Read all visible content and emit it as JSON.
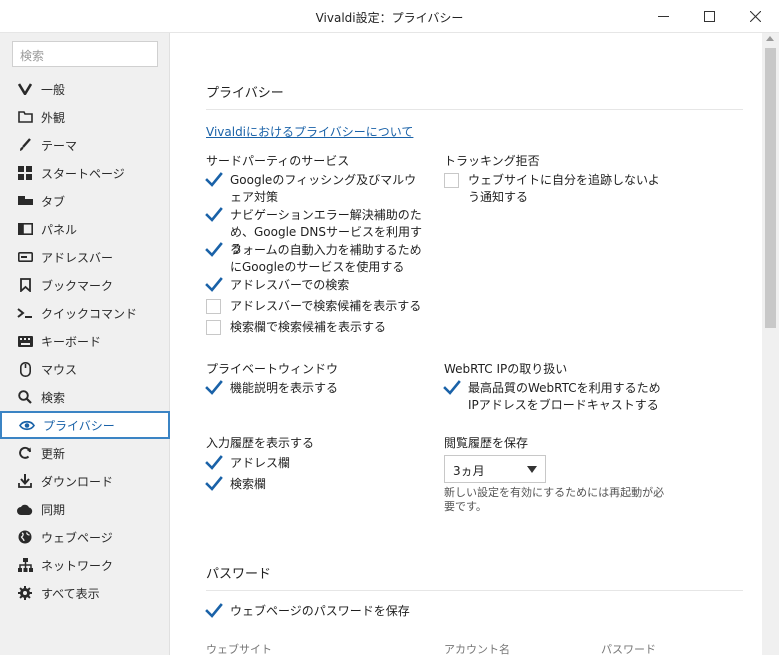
{
  "window": {
    "title": "Vivaldi設定：プライバシー"
  },
  "sidebar": {
    "search_placeholder": "検索",
    "items": [
      {
        "label": "一般",
        "icon": "vivaldi-v-icon"
      },
      {
        "label": "外観",
        "icon": "folder-icon"
      },
      {
        "label": "テーマ",
        "icon": "brush-icon"
      },
      {
        "label": "スタートページ",
        "icon": "grid-icon"
      },
      {
        "label": "タブ",
        "icon": "tab-icon"
      },
      {
        "label": "パネル",
        "icon": "panel-icon"
      },
      {
        "label": "アドレスバー",
        "icon": "address-bar-icon"
      },
      {
        "label": "ブックマーク",
        "icon": "bookmark-icon"
      },
      {
        "label": "クイックコマンド",
        "icon": "quick-command-icon"
      },
      {
        "label": "キーボード",
        "icon": "keyboard-icon"
      },
      {
        "label": "マウス",
        "icon": "mouse-icon"
      },
      {
        "label": "検索",
        "icon": "search-icon"
      },
      {
        "label": "プライバシー",
        "icon": "eye-icon",
        "active": true
      },
      {
        "label": "更新",
        "icon": "refresh-icon"
      },
      {
        "label": "ダウンロード",
        "icon": "download-icon"
      },
      {
        "label": "同期",
        "icon": "cloud-icon"
      },
      {
        "label": "ウェブページ",
        "icon": "globe-icon"
      },
      {
        "label": "ネットワーク",
        "icon": "network-icon"
      },
      {
        "label": "すべて表示",
        "icon": "gear-icon"
      }
    ]
  },
  "privacy": {
    "title": "プライバシー",
    "link": "Vivaldiにおけるプライバシーについて",
    "third_party": {
      "title": "サードパーティのサービス",
      "items": [
        {
          "label": "Googleのフィッシング及びマルウェア対策",
          "checked": true
        },
        {
          "label": "ナビゲーションエラー解決補助のため、Google DNSサービスを利用する",
          "checked": true
        },
        {
          "label": "フォームの自動入力を補助するためにGoogleのサービスを使用する",
          "checked": true
        },
        {
          "label": "アドレスバーでの検索",
          "checked": true
        },
        {
          "label": "アドレスバーで検索候補を表示する",
          "checked": false
        },
        {
          "label": "検索欄で検索候補を表示する",
          "checked": false
        }
      ]
    },
    "tracking": {
      "title": "トラッキング拒否",
      "item": {
        "label": "ウェブサイトに自分を追跡しないよう通知する",
        "checked": false
      }
    },
    "private_window": {
      "title": "プライベートウィンドウ",
      "item": {
        "label": "機能説明を表示する",
        "checked": true
      }
    },
    "webrtc": {
      "title": "WebRTC IPの取り扱い",
      "item": {
        "label": "最高品質のWebRTCを利用するためIPアドレスをブロードキャストする",
        "checked": true
      }
    },
    "input_history": {
      "title": "入力履歴を表示する",
      "items": [
        {
          "label": "アドレス欄",
          "checked": true
        },
        {
          "label": "検索欄",
          "checked": true
        }
      ]
    },
    "browsing_history": {
      "title": "閲覧履歴を保存",
      "selected": "3ヵ月",
      "note": "新しい設定を有効にするためには再起動が必要です。"
    }
  },
  "passwords": {
    "title": "パスワード",
    "save": {
      "label": "ウェブページのパスワードを保存",
      "checked": true
    },
    "columns": [
      "ウェブサイト",
      "アカウント名",
      "パスワード"
    ]
  },
  "colors": {
    "accent": "#1a62a8",
    "active_border": "#3b84c4",
    "sidebar_bg": "#f0f0f0"
  }
}
